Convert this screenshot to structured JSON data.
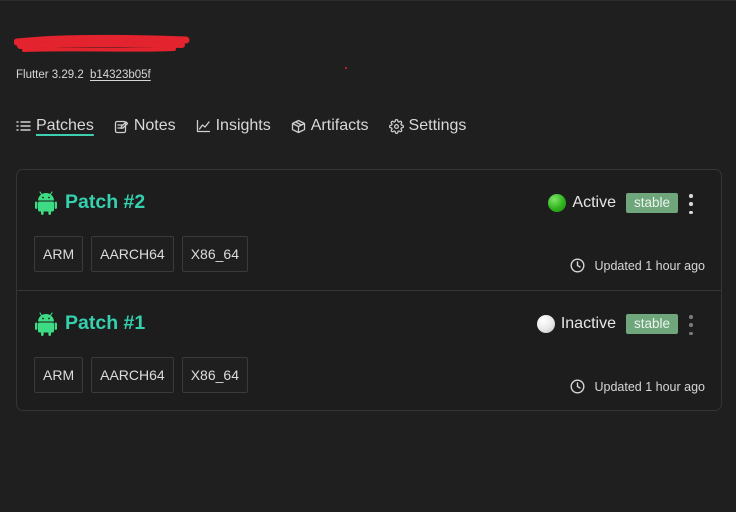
{
  "header": {
    "flutter_label": "Flutter 3.29.2",
    "commit_hash": "b14323b05f"
  },
  "tabs": [
    {
      "label": "Patches",
      "icon": "list-icon",
      "active": true
    },
    {
      "label": "Notes",
      "icon": "notes-icon",
      "active": false
    },
    {
      "label": "Insights",
      "icon": "chart-line-icon",
      "active": false
    },
    {
      "label": "Artifacts",
      "icon": "package-icon",
      "active": false
    },
    {
      "label": "Settings",
      "icon": "gear-icon",
      "active": false
    }
  ],
  "patches": [
    {
      "title": "Patch #2",
      "platform_icon": "android-icon",
      "status": "Active",
      "status_color": "#2fb21e",
      "channel": "stable",
      "archs": [
        "ARM",
        "AARCH64",
        "X86_64"
      ],
      "updated": "Updated 1 hour ago"
    },
    {
      "title": "Patch #1",
      "platform_icon": "android-icon",
      "status": "Inactive",
      "status_color": "#e7e7e7",
      "channel": "stable",
      "archs": [
        "ARM",
        "AARCH64",
        "X86_64"
      ],
      "updated": "Updated 1 hour ago"
    }
  ],
  "colors": {
    "accent": "#35d0ad",
    "background": "#1f1f1f",
    "badge": "#6fa67c",
    "android": "#3ddc84"
  }
}
